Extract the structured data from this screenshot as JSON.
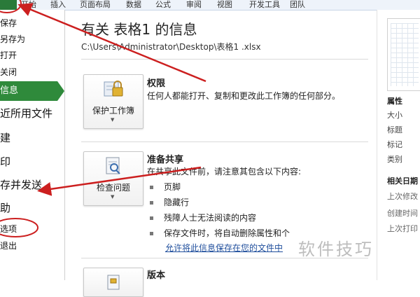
{
  "ribbon": {
    "tabs": [
      "开始",
      "插入",
      "页面布局",
      "数据",
      "公式",
      "审阅",
      "视图",
      "开发工具",
      "团队"
    ]
  },
  "nav": {
    "save": "保存",
    "save_as": "另存为",
    "open": "打开",
    "close": "关闭",
    "info": "信息",
    "recent": "近所用文件",
    "new": "建",
    "print": "印",
    "save_send": "存并发送",
    "help": "助",
    "options": "选项",
    "exit": "退出"
  },
  "main": {
    "title": "有关 表格1 的信息",
    "path": "C:\\Users\\Administrator\\Desktop\\表格1 .xlsx",
    "permissions": {
      "button_label": "保护工作簿",
      "heading": "权限",
      "text": "任何人都能打开、复制和更改此工作簿的任何部分。"
    },
    "prepare": {
      "button_label": "检查问题",
      "heading": "准备共享",
      "text": "在共享此文件前，请注意其包含以下内容:",
      "bullets": [
        "页脚",
        "隐藏行",
        "残障人士无法阅读的内容",
        "保存文件时，将自动删除属性和个"
      ],
      "link": "允许将此信息保存在您的文件中"
    },
    "versions": {
      "heading": "版本"
    }
  },
  "right_panel": {
    "properties": "属性",
    "size": "大小",
    "title": "标题",
    "tags": "标记",
    "category": "类别",
    "related_dates": "相关日期",
    "last_modified": "上次修改",
    "created": "创建时间",
    "last_printed": "上次打印"
  },
  "watermark": "软件技巧",
  "colors": {
    "accent_green": "#2f8a3b",
    "annotation_red": "#cc1f1f",
    "link_blue": "#1f4e9c"
  }
}
